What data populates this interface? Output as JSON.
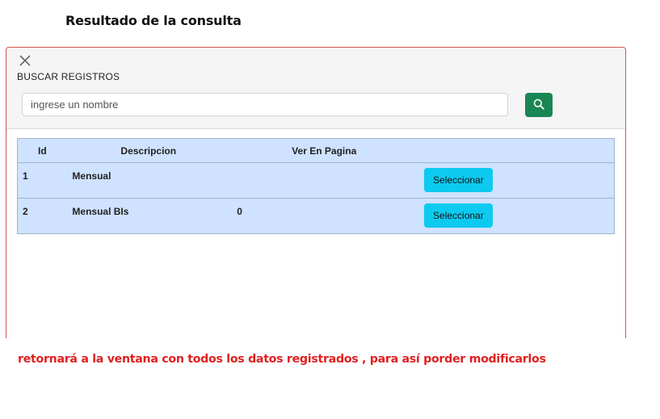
{
  "page": {
    "title": "Resultado de la consulta",
    "footer_note": "retornará a la ventana con todos los datos registrados , para así porder modificarlos"
  },
  "modal": {
    "close_icon": "close-icon",
    "heading": "BUSCAR REGISTROS",
    "search": {
      "placeholder": "ingrese un nombre",
      "value": "",
      "button_icon": "search-icon"
    },
    "table": {
      "columns": [
        "Id",
        "Descripcion",
        "Ver En Pagina",
        ""
      ],
      "rows": [
        {
          "id": "1",
          "descripcion": "Mensual",
          "ver_en_pagina": "",
          "action": "Seleccionar"
        },
        {
          "id": "2",
          "descripcion": "Mensual BIs",
          "ver_en_pagina": "0",
          "action": "Seleccionar"
        }
      ]
    }
  },
  "colors": {
    "accent_success": "#198754",
    "accent_info": "#0dcaf0",
    "table_bg": "#cfe2ff",
    "note_red": "#e02020",
    "modal_border": "#d9534f"
  }
}
